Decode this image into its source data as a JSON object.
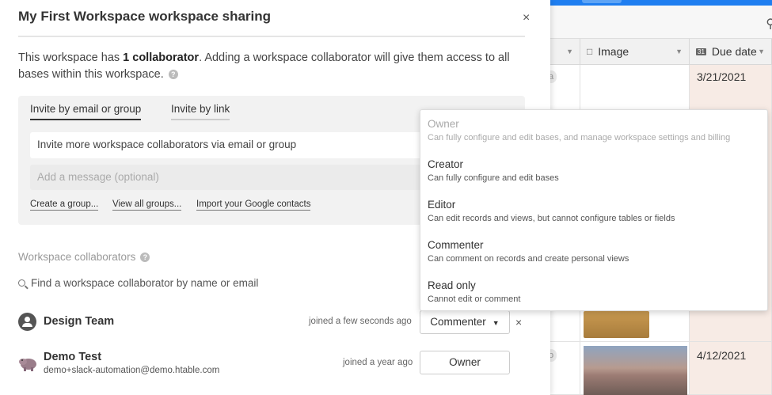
{
  "modal": {
    "title": "My First Workspace workspace sharing",
    "close_icon": "×",
    "desc_pre": "This workspace has ",
    "desc_bold": "1 collaborator",
    "desc_post": ". Adding a workspace collaborator will give them access to all bases within this workspace.",
    "help_icon": "?"
  },
  "invite": {
    "tab_email": "Invite by email or group",
    "tab_link": "Invite by link",
    "input_value": "Invite more workspace collaborators via email or group",
    "message_placeholder": "Add a message (optional)",
    "link_create_group": "Create a group...",
    "link_view_groups": "View all groups...",
    "link_import": "Import your Google contacts"
  },
  "collaborators": {
    "label": "Workspace collaborators",
    "help_icon": "?",
    "find_placeholder": "Find a workspace collaborator by name or email",
    "rows": [
      {
        "name": "Design Team",
        "email": "",
        "joined": "joined a few seconds ago",
        "role": "Commenter",
        "role_caret": "▼",
        "remove": "×"
      },
      {
        "name": "Demo Test",
        "email": "demo+slack-automation@demo.htable.com",
        "joined": "joined a year ago",
        "role": "Owner"
      }
    ]
  },
  "permission_menu": [
    {
      "title": "Owner",
      "desc": "Can fully configure and edit bases, and manage workspace settings and billing",
      "disabled": true
    },
    {
      "title": "Creator",
      "desc": "Can fully configure and edit bases"
    },
    {
      "title": "Editor",
      "desc": "Can edit records and views, but cannot configure tables or fields"
    },
    {
      "title": "Commenter",
      "desc": "Can comment on records and create personal views"
    },
    {
      "title": "Read only",
      "desc": "Cannot edit or comment"
    }
  ],
  "grid": {
    "columns": [
      {
        "label": "",
        "caret": "▼"
      },
      {
        "label": "Image",
        "caret": "▼"
      },
      {
        "label": "Due date",
        "caret": "▼",
        "icon": "31"
      }
    ],
    "dates": [
      "3/21/2021",
      "4/12/2021"
    ],
    "pills": [
      "a",
      "o"
    ]
  },
  "colors": {
    "accent": "#1f7ef0",
    "due_bg": "#f7ebe5"
  }
}
